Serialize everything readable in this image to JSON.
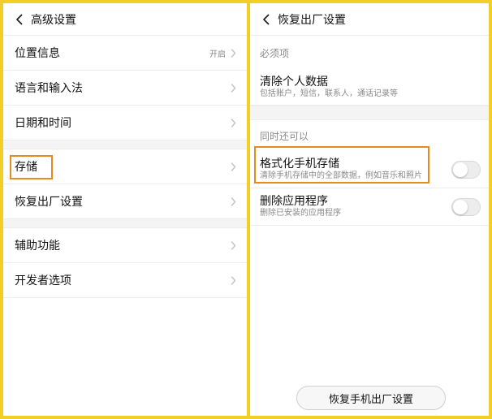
{
  "colors": {
    "border_yellow": "#f2cf27",
    "highlight_orange": "#e88b1c"
  },
  "left_panel": {
    "title": "高级设置",
    "items": [
      {
        "label": "位置信息",
        "value": "开启"
      },
      {
        "label": "语言和输入法"
      },
      {
        "label": "日期和时间"
      },
      {
        "label": "存储"
      },
      {
        "label": "恢复出厂设置"
      },
      {
        "label": "辅助功能"
      },
      {
        "label": "开发者选项"
      }
    ]
  },
  "right_panel": {
    "title": "恢复出厂设置",
    "section_required": "必须项",
    "clear_data": {
      "title": "清除个人数据",
      "subtitle": "包括账户，短信，联系人，通话记录等"
    },
    "section_optional": "同时还可以",
    "format_storage": {
      "title": "格式化手机存储",
      "subtitle": "清除手机存储中的全部数据，例如音乐和照片",
      "enabled": false
    },
    "delete_apps": {
      "title": "删除应用程序",
      "subtitle": "删除已安装的应用程序",
      "enabled": false
    },
    "reset_button": "恢复手机出厂设置"
  }
}
